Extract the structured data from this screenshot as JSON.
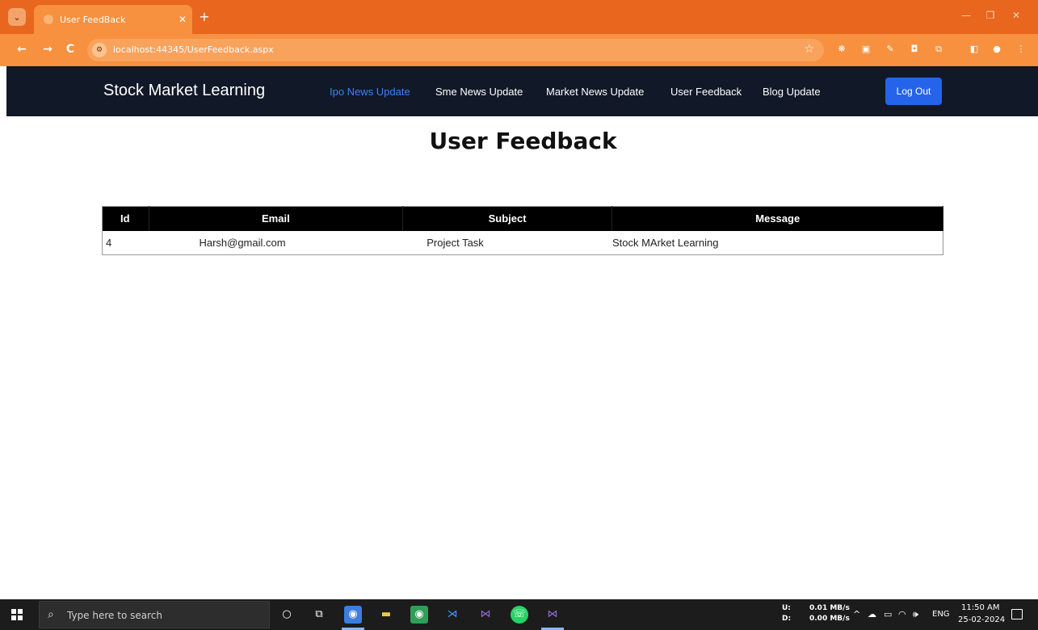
{
  "browser": {
    "tab_title": "User FeedBack",
    "url": "localhost:44345/UserFeedback.aspx"
  },
  "navbar": {
    "brand": "Stock Market Learning",
    "links": [
      {
        "label": "Ipo News Update",
        "active": true
      },
      {
        "label": "Sme News Update",
        "active": false
      },
      {
        "label": "Market News Update",
        "active": false
      },
      {
        "label": "User Feedback",
        "active": false
      },
      {
        "label": "Blog Update",
        "active": false
      }
    ],
    "logout_label": "Log Out"
  },
  "page": {
    "title": "User Feedback"
  },
  "feedback_table": {
    "headers": {
      "id": "Id",
      "email": "Email",
      "subject": "Subject",
      "message": "Message"
    },
    "rows": [
      {
        "id": "4",
        "email": "Harsh@gmail.com",
        "subject": "Project Task",
        "message": "Stock MArket Learning"
      }
    ]
  },
  "taskbar": {
    "search_placeholder": "Type here to search",
    "net_up_label": "U:",
    "net_down_label": "D:",
    "net_up": "0.01 MB/s",
    "net_down": "0.00 MB/s",
    "lang": "ENG",
    "time": "11:50 AM",
    "date": "25-02-2024"
  },
  "colors": {
    "chrome_tabbar": "#e8661e",
    "chrome_toolbar": "#f7913f",
    "navbar_bg": "#111827",
    "nav_active": "#3b82f6",
    "logout_bg": "#2563eb",
    "table_header_bg": "#000000"
  }
}
